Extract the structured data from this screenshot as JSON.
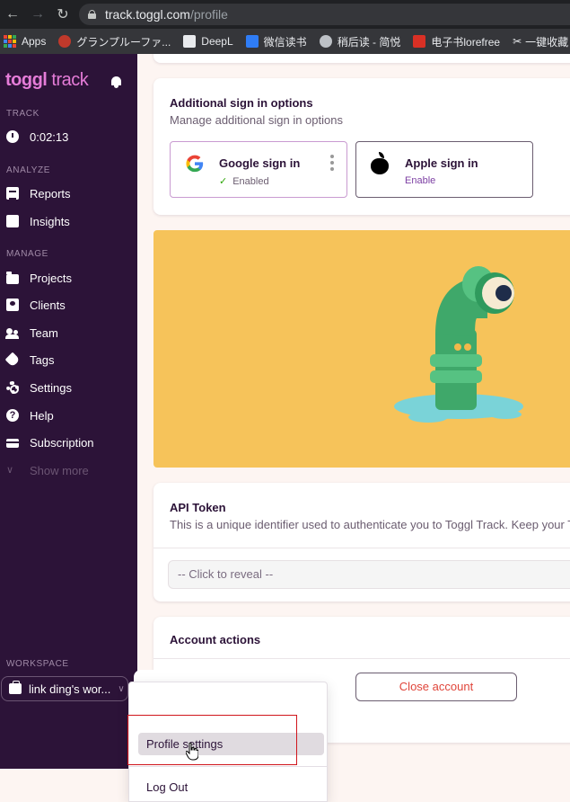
{
  "browser": {
    "url_host": "track.toggl.com",
    "url_path": "/profile",
    "bookmarks": [
      {
        "label": "Apps",
        "icon": "apps-grid-icon",
        "color": "#ea4335"
      },
      {
        "label": "グランプルーファ...",
        "icon": "game-favicon",
        "color": "#c0392b"
      },
      {
        "label": "DeepL",
        "icon": "deepl-favicon",
        "color": "#0f2b46"
      },
      {
        "label": "微信读书",
        "icon": "weread-favicon",
        "color": "#2f7df6"
      },
      {
        "label": "稍后读 - 简悦",
        "icon": "globe-icon",
        "color": "#bdc1c6"
      },
      {
        "label": "电子书lorefree",
        "icon": "book-favicon",
        "color": "#d93025"
      },
      {
        "label": "一键收藏",
        "icon": "scissors-icon",
        "color": "#e8eaed"
      }
    ]
  },
  "sidebar": {
    "logo_bold": "toggl",
    "logo_light": " track",
    "sections": {
      "track": "TRACK",
      "analyze": "ANALYZE",
      "manage": "MANAGE"
    },
    "timer": "0:02:13",
    "items": {
      "reports": "Reports",
      "insights": "Insights",
      "projects": "Projects",
      "clients": "Clients",
      "team": "Team",
      "tags": "Tags",
      "settings": "Settings",
      "help": "Help",
      "subscription": "Subscription",
      "show_more": "Show more"
    },
    "workspace_label": "WORKSPACE",
    "workspace_name": "link ding's wor..."
  },
  "signin": {
    "title": "Additional sign in options",
    "subtitle": "Manage additional sign in options",
    "google": {
      "title": "Google sign in",
      "status": "Enabled"
    },
    "apple": {
      "title": "Apple sign in",
      "status": "Enable"
    }
  },
  "api_token": {
    "title": "API Token",
    "subtitle": "This is a unique identifier used to authenticate you to Toggl Track. Keep your Tok",
    "reveal": "-- Click to reveal --"
  },
  "account": {
    "title": "Account actions",
    "close_label": "Close account"
  },
  "menu": {
    "profile": "Profile settings",
    "logout": "Log Out"
  },
  "colors": {
    "sidebar_bg": "#2c1338",
    "brand_pink": "#e57cd8",
    "hero_bg": "#f6c35a",
    "danger": "#e0453a",
    "highlight_box": "#d0151c"
  }
}
